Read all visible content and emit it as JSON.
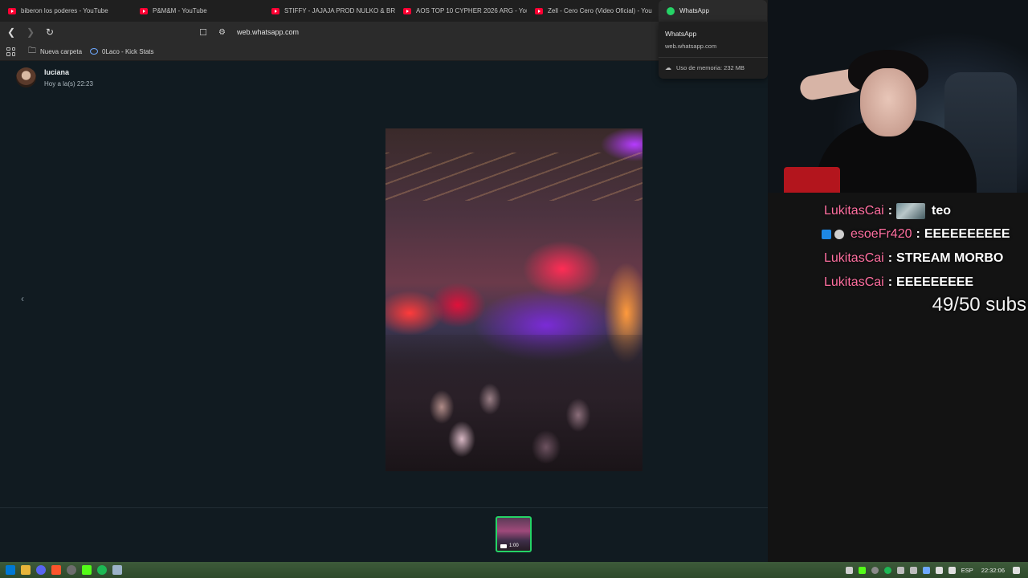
{
  "browser": {
    "tabs": [
      {
        "title": "biberon los poderes - YouTube",
        "icon": "youtube-icon",
        "active": false
      },
      {
        "title": "P&M&M - YouTube",
        "icon": "youtube-icon",
        "active": false
      },
      {
        "title": "STIFFY - JAJAJA PROD NULKO & BRI",
        "icon": "youtube-icon",
        "active": false
      },
      {
        "title": "AOS TOP 10 CYPHER 2026 ARG - You",
        "icon": "youtube-icon",
        "active": false
      },
      {
        "title": "Zell - Cero Cero (Video Oficial) - You",
        "icon": "youtube-icon",
        "active": false
      },
      {
        "title": "WhatsApp",
        "icon": "whatsapp-icon",
        "active": true
      }
    ],
    "url": "web.whatsapp.com",
    "bookmarks": [
      {
        "label": "Nueva carpeta",
        "icon": "folder-icon"
      },
      {
        "label": "0Laco - Kick Stats",
        "icon": "kick-icon"
      }
    ]
  },
  "hover_card": {
    "title": "WhatsApp",
    "url": "web.whatsapp.com",
    "memory": "Uso de memoria: 232 MB"
  },
  "viewer": {
    "sender_name": "luciana",
    "timestamp": "Hoy a la(s) 22:23",
    "thumbnail_duration": "1:00"
  },
  "stream": {
    "chat": [
      {
        "user": "LukitasCai",
        "message": "teo",
        "emote": true,
        "badges": []
      },
      {
        "user": "esoeFr420",
        "message": "EEEEEEEEEE",
        "emote": false,
        "badges": [
          "badge-blue",
          "badge-gray"
        ]
      },
      {
        "user": "LukitasCai",
        "message": "STREAM MORBO",
        "emote": false,
        "badges": []
      },
      {
        "user": "LukitasCai",
        "message": "EEEEEEEEE",
        "emote": false,
        "badges": []
      }
    ],
    "subs_goal": "49/50 subs",
    "colors": {
      "username": "#ff6fa0",
      "message": "#ffffff"
    }
  },
  "taskbar": {
    "language": "ESP",
    "clock": "22:32:06"
  },
  "colors": {
    "whatsapp_green": "#25d366",
    "viewer_bg": "#111b21",
    "chrome_bg": "#2b2b2b"
  }
}
